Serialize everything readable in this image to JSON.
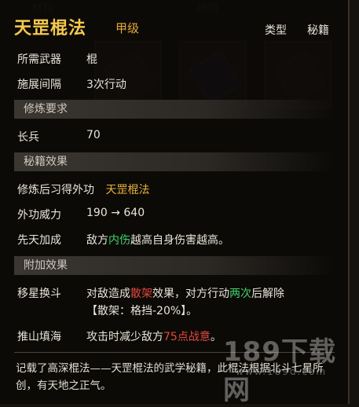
{
  "background": {
    "tabs": [
      "材料",
      "地图"
    ]
  },
  "tooltip": {
    "title": "天罡棍法",
    "grade": "甲级",
    "type_label": "类型",
    "type_value": "秘籍",
    "required_weapon_label": "所需武器",
    "required_weapon_value": "棍",
    "cast_interval_label": "施展间隔",
    "cast_interval_value": "3次行动",
    "section_training": "修炼要求",
    "long_weapon_label": "长兵",
    "long_weapon_value": "70",
    "section_effect": "秘籍效果",
    "learn_label": "修炼后习得外功",
    "learn_value": "天罡棍法",
    "power_label": "外功威力",
    "power_from": "190",
    "power_arrow": "→",
    "power_to": "640",
    "first_label": "先天加成",
    "first_text_1": "敌方",
    "first_text_hl": "内伤",
    "first_text_2": "越高自身伤害越高。",
    "section_extra": "附加效果",
    "move_label": "移星换斗",
    "move_text_1": "对敌造成",
    "move_text_hl1": "散架",
    "move_text_2": "效果，对方行动",
    "move_text_hl2": "两次",
    "move_text_3": "后解除",
    "move_line2": "【散架：格挡-20%】。",
    "push_label": "推山填海",
    "push_text_1": "攻击时减少敌方",
    "push_text_hl": "75点战意",
    "push_text_2": "。",
    "description": "记载了高深棍法——天罡棍法的武学秘籍，此棍法根据北斗七星所创，有天地之正气。"
  },
  "watermark": {
    "big": "189下载网",
    "small": "www.189d.com"
  },
  "colors": {
    "title": "#f4c94e",
    "grade": "#e3a93a",
    "gold": "#e8b33a",
    "green": "#3fd36a",
    "red": "#e3483c"
  }
}
